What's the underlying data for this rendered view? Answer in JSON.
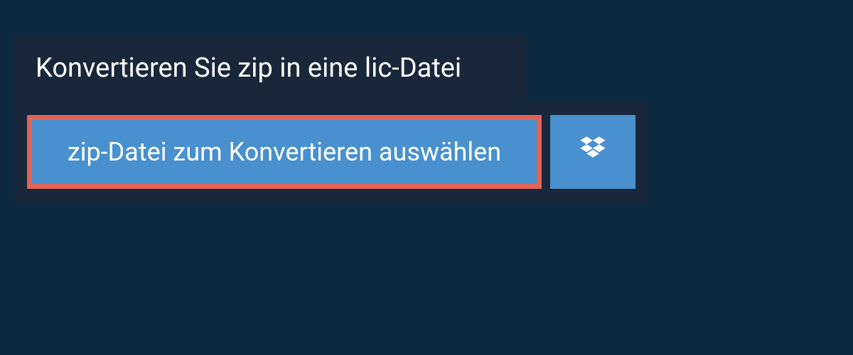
{
  "header": {
    "title": "Konvertieren Sie zip in eine lic-Datei"
  },
  "actions": {
    "select_file_label": "zip-Datei zum Konvertieren auswählen",
    "dropbox_icon": "dropbox"
  },
  "colors": {
    "background": "#0e2a40",
    "panel": "#18283a",
    "button": "#4890ce",
    "highlight_border": "#e36256"
  }
}
